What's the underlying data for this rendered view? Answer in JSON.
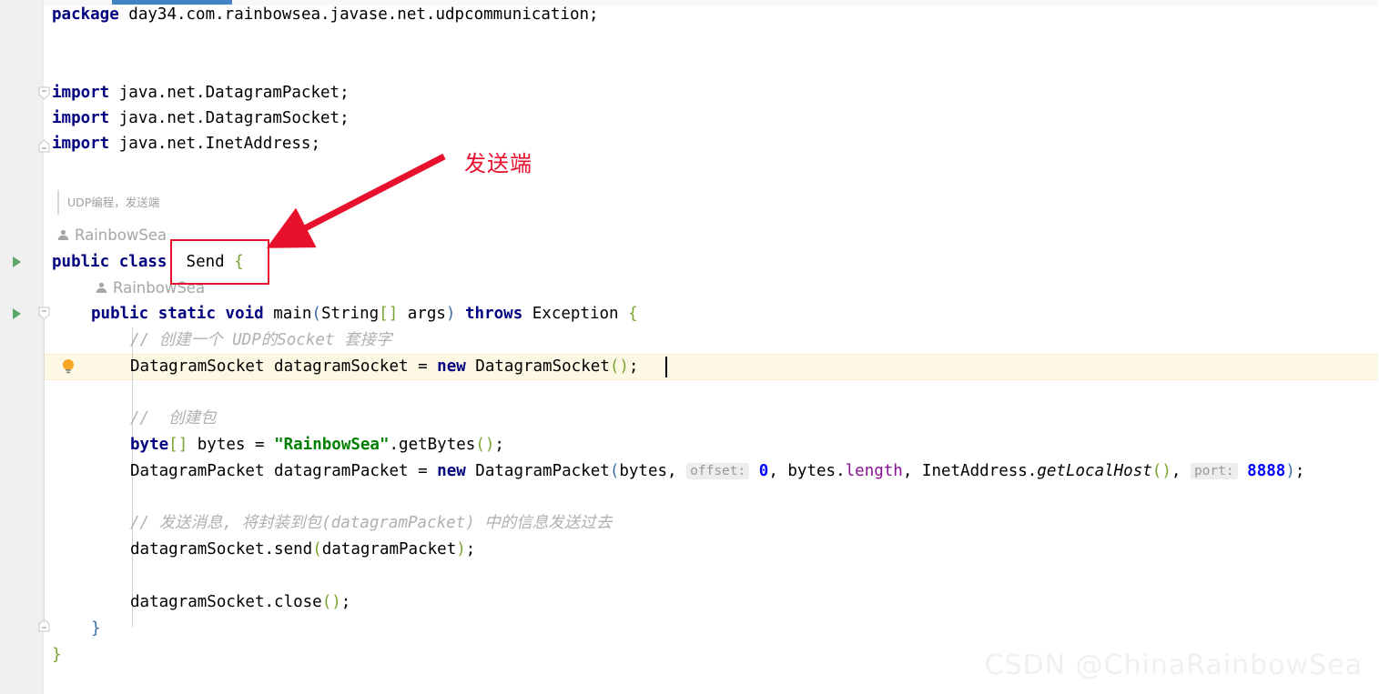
{
  "editor": {
    "tab_indicator_color": "#4183c4",
    "caret_line_color": "#fdf8e3",
    "doc_comment": "UDP编程，发送端",
    "author_label_class": "RainbowSea",
    "author_label_method": "RainbowSea",
    "lines": {
      "package": {
        "kw": "package",
        "rest": " day34.com.rainbowsea.javase.net.udpcommunication;"
      },
      "import1_kw": "import",
      "import1_rest": " java.net.DatagramPacket;",
      "import2_kw": "import",
      "import2_rest": " java.net.DatagramSocket;",
      "import3_kw": "import",
      "import3_rest": " java.net.InetAddress;",
      "class_kw1": "public",
      "class_kw2": "class",
      "class_name": "Send",
      "class_brace": "{",
      "method_kw1": "public",
      "method_kw2": "static",
      "method_kw3": "void",
      "method_name": "main",
      "method_paren_open": "(",
      "method_param_type": "String",
      "method_param_brackets": "[]",
      "method_param_name": " args",
      "method_paren_close": ")",
      "method_kw4": "throws",
      "method_exception": " Exception ",
      "method_brace": "{",
      "comment1": "// 创建一个 UDP的Socket 套接字",
      "stmt1_type": "DatagramSocket datagramSocket = ",
      "stmt1_new": "new",
      "stmt1_ctor": " DatagramSocket",
      "stmt1_parens": "()",
      "stmt1_semi": ";",
      "comment2": "//  创建包",
      "stmt2_kw": "byte",
      "stmt2_brackets": "[]",
      "stmt2_var": " bytes = ",
      "stmt2_str": "\"RainbowSea\"",
      "stmt2_dot": ".getBytes",
      "stmt2_parens": "()",
      "stmt2_semi": ";",
      "stmt3_prefix": "DatagramPacket datagramPacket = ",
      "stmt3_new": "new",
      "stmt3_ctor": " DatagramPacket",
      "stmt3_paren_open": "(",
      "stmt3_arg1": "bytes, ",
      "stmt3_hint_offset": "offset:",
      "stmt3_offset_value": "0",
      "stmt3_arg2_obj": ", bytes.",
      "stmt3_arg2_field": "length",
      "stmt3_arg3_obj": ", InetAddress.",
      "stmt3_arg3_method": "getLocalHost",
      "stmt3_arg3_parens": "()",
      "stmt3_comma": ", ",
      "stmt3_hint_port": "port:",
      "stmt3_port_value": "8888",
      "stmt3_paren_close": ")",
      "stmt3_semi": ";",
      "comment3": "// 发送消息, 将封装到包(datagramPacket) 中的信息发送过去",
      "stmt4_obj": "datagramSocket.send",
      "stmt4_paren_open": "(",
      "stmt4_arg": "datagramPacket",
      "stmt4_paren_close": ")",
      "stmt4_semi": ";",
      "stmt5_obj": "datagramSocket.close",
      "stmt5_parens": "()",
      "stmt5_semi": ";",
      "method_close_brace": "}",
      "class_close_brace": "}"
    }
  },
  "annotations": {
    "callout_label": "发送端",
    "callout_color": "#e8112d",
    "box_target": "Send {"
  },
  "watermark": {
    "text": "CSDN @ChinaRainbowSea"
  },
  "icons": {
    "run": "run-gutter-icon",
    "bulb": "intention-bulb-icon",
    "fold": "code-fold-icon",
    "person": "author-person-icon"
  }
}
